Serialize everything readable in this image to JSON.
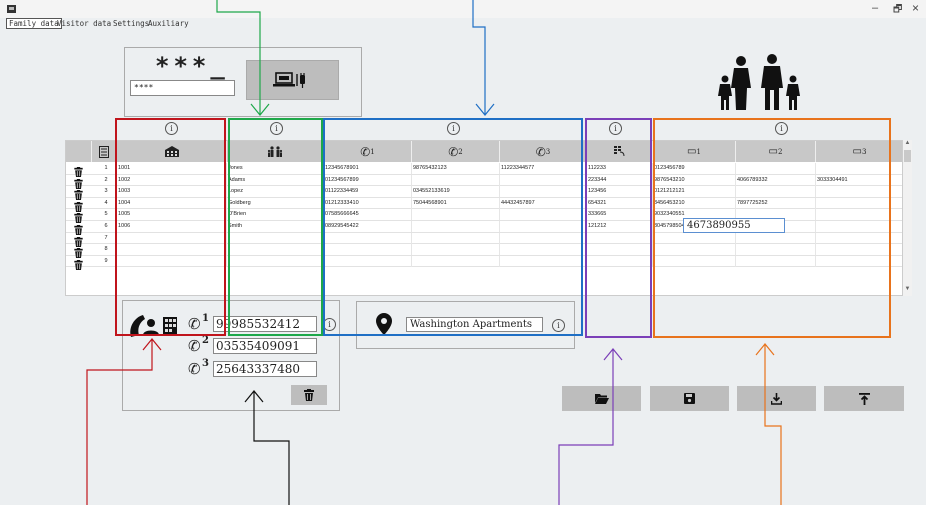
{
  "menu": {
    "items": [
      "Family data",
      "Visitor data",
      "Settings",
      "Auxiliary"
    ]
  },
  "window": {
    "minimize": "–",
    "restore": "🗗",
    "close": "×"
  },
  "password": {
    "stars": "***_",
    "input_value": "****"
  },
  "info_symbol": "i",
  "table": {
    "rows": [
      {
        "num": "1",
        "id": "1001",
        "name": "Jones",
        "phone1": "12345678901",
        "phone2": "98765432123",
        "phone3": "11223344577",
        "code": "112233",
        "sms1": "0123456789",
        "sms2": "",
        "sms3": ""
      },
      {
        "num": "2",
        "id": "1002",
        "name": "Adams",
        "phone1": "01234567899",
        "phone2": "",
        "phone3": "",
        "code": "223344",
        "sms1": "9876543210",
        "sms2": "4066789332",
        "sms3": "3033304491"
      },
      {
        "num": "3",
        "id": "1003",
        "name": "Lopez",
        "phone1": "01122334459",
        "phone2": "034552133619",
        "phone3": "",
        "code": "123456",
        "sms1": "0121212121",
        "sms2": "",
        "sms3": ""
      },
      {
        "num": "4",
        "id": "1004",
        "name": "Goldberg",
        "phone1": "01212333410",
        "phone2": "75044568901",
        "phone3": "44432457897",
        "code": "654321",
        "sms1": "3456453210",
        "sms2": "7897725252",
        "sms3": ""
      },
      {
        "num": "5",
        "id": "1005",
        "name": "O'Brien",
        "phone1": "07585666645",
        "phone2": "",
        "phone3": "",
        "code": "333665",
        "sms1": "9032340551",
        "sms2": "",
        "sms3": ""
      },
      {
        "num": "6",
        "id": "1006",
        "name": "Smith",
        "phone1": "08929545422",
        "phone2": "",
        "phone3": "",
        "code": "121212",
        "sms1": "3045798504",
        "sms2": "",
        "sms3": ""
      },
      {
        "num": "7",
        "id": "",
        "name": "",
        "phone1": "",
        "phone2": "",
        "phone3": "",
        "code": "",
        "sms1": "",
        "sms2": "",
        "sms3": ""
      },
      {
        "num": "8",
        "id": "",
        "name": "",
        "phone1": "",
        "phone2": "",
        "phone3": "",
        "code": "",
        "sms1": "",
        "sms2": "",
        "sms3": ""
      },
      {
        "num": "9",
        "id": "",
        "name": "",
        "phone1": "",
        "phone2": "",
        "phone3": "",
        "code": "",
        "sms1": "",
        "sms2": "",
        "sms3": ""
      }
    ],
    "editing_value": "4673890955",
    "header_sub": {
      "p1": "1",
      "p2": "2",
      "p3": "3",
      "s1": "1",
      "s2": "2",
      "s3": "3"
    }
  },
  "phones": {
    "labels": [
      "1",
      "2",
      "3"
    ],
    "values": [
      "99985532412",
      "03535409091",
      "25643337480"
    ]
  },
  "address": {
    "value": "Washington Apartments"
  },
  "annotation_colors": {
    "red": "#c0141c",
    "green": "#1ea84a",
    "blue": "#1f6fc5",
    "purple": "#7b3fb8",
    "orange": "#e8731c"
  }
}
